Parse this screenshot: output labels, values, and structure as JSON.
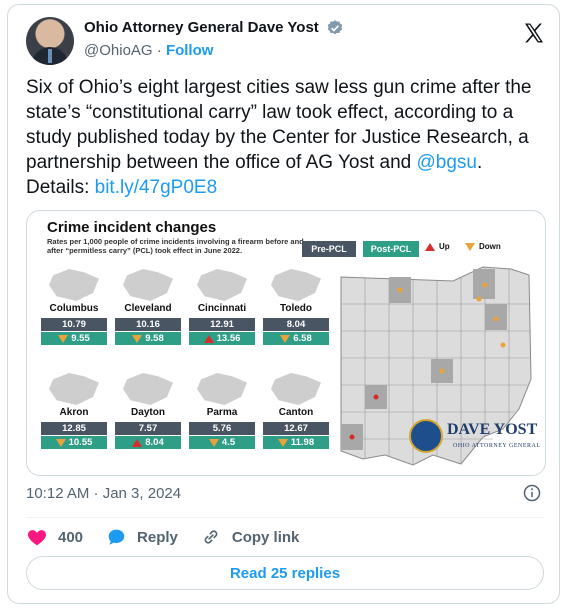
{
  "tweet": {
    "author_name": "Ohio Attorney General Dave Yost",
    "handle": "@OhioAG",
    "separator": " · ",
    "follow_label": "Follow",
    "text_before_link": "Six of Ohio’s eight largest cities saw less gun crime after the state’s “constitutional carry” law took effect, according to a study published today by the Center for Justice Research, a partnership between the office of AG Yost and ",
    "mention": "@bgsu",
    "text_after_mention": ". Details: ",
    "link": "bit.ly/47gP0E8",
    "timestamp": "10:12 AM · Jan 3, 2024",
    "likes_count": "400",
    "reply_label": "Reply",
    "copy_link_label": "Copy link",
    "read_replies_label": "Read 25 replies"
  },
  "infographic": {
    "title": "Crime incident changes",
    "subtitle": "Rates per 1,000 people of crime incidents involving a firearm before and after “permitless carry” (PCL) took effect in June 2022.",
    "legend_pre": "Pre-PCL",
    "legend_post": "Post-PCL",
    "legend_up": "Up",
    "legend_down": "Down",
    "cities": [
      {
        "name": "Columbus",
        "pre": "10.79",
        "post": "9.55",
        "direction": "down"
      },
      {
        "name": "Cleveland",
        "pre": "10.16",
        "post": "9.58",
        "direction": "down"
      },
      {
        "name": "Cincinnati",
        "pre": "12.91",
        "post": "13.56",
        "direction": "up"
      },
      {
        "name": "Toledo",
        "pre": "8.04",
        "post": "6.58",
        "direction": "down"
      },
      {
        "name": "Akron",
        "pre": "12.85",
        "post": "10.55",
        "direction": "down"
      },
      {
        "name": "Dayton",
        "pre": "7.57",
        "post": "8.04",
        "direction": "up"
      },
      {
        "name": "Parma",
        "pre": "5.76",
        "post": "4.5",
        "direction": "down"
      },
      {
        "name": "Canton",
        "pre": "12.67",
        "post": "11.98",
        "direction": "down"
      }
    ],
    "logo_name": "DAVE YOST",
    "logo_subtitle": "OHIO ATTORNEY GENERAL"
  },
  "colors": {
    "link_blue": "#1d9bf0",
    "pre_pcl": "#4a5563",
    "post_pcl": "#2e9e86",
    "up": "#d62d2d",
    "down": "#e8a33a",
    "like_pink": "#f91880"
  },
  "icons": [
    "verified-badge-icon",
    "x-logo-icon",
    "info-icon",
    "heart-icon",
    "reply-bubble-icon",
    "link-icon"
  ]
}
